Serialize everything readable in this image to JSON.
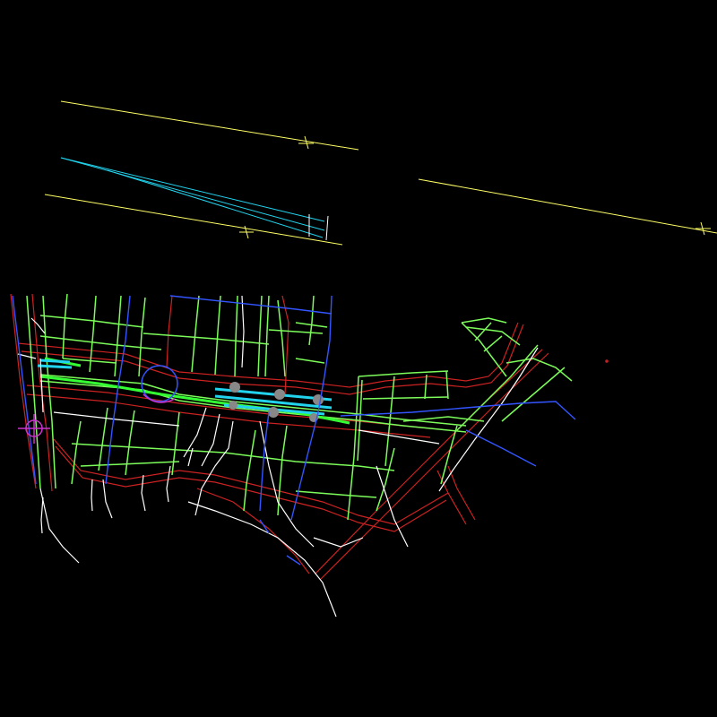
{
  "drawing": {
    "background": "#000000",
    "layers": [
      {
        "name": "road-centerline",
        "color": "#ffff66"
      },
      {
        "name": "rail-track",
        "color": "#22d3ee"
      },
      {
        "name": "road-edge-green",
        "color": "#7CFC5A"
      },
      {
        "name": "road-edge-white",
        "color": "#ffffff"
      },
      {
        "name": "boundary-red",
        "color": "#cc2222"
      },
      {
        "name": "street-blue",
        "color": "#3355ff"
      },
      {
        "name": "marker-magenta",
        "color": "#cc33cc"
      },
      {
        "name": "station-gray",
        "color": "#888888"
      }
    ]
  }
}
